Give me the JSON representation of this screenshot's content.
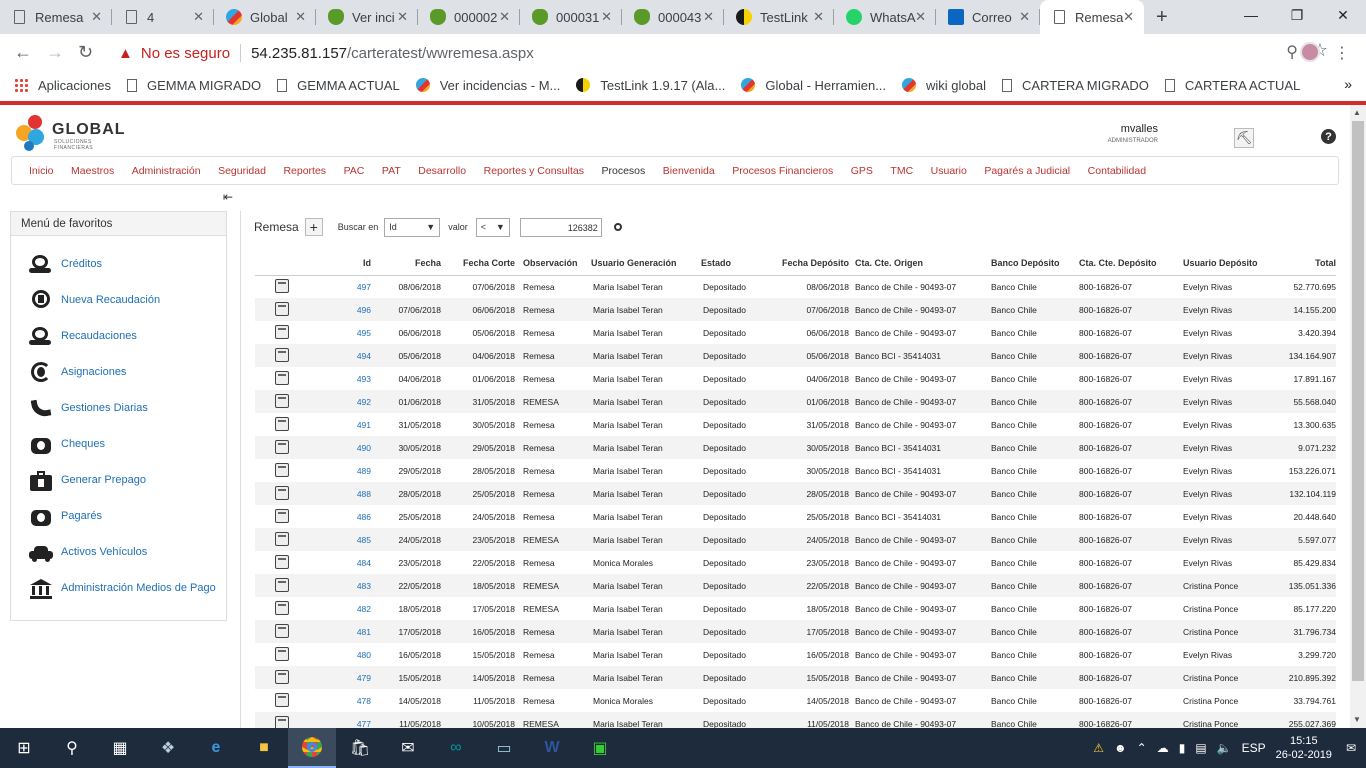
{
  "browser": {
    "tabs": [
      {
        "title": "Remesa",
        "icon": "doc-icon"
      },
      {
        "title": "4",
        "icon": "doc-icon"
      },
      {
        "title": "Global",
        "icon": "global-icon"
      },
      {
        "title": "Ver inci",
        "icon": "frog-icon"
      },
      {
        "title": "000002",
        "icon": "frog-icon"
      },
      {
        "title": "000031",
        "icon": "frog-icon"
      },
      {
        "title": "000043",
        "icon": "frog-icon"
      },
      {
        "title": "TestLink",
        "icon": "testlink-icon"
      },
      {
        "title": "WhatsA",
        "icon": "whatsapp-icon"
      },
      {
        "title": "Correo",
        "icon": "outlook-icon"
      },
      {
        "title": "Remesa",
        "icon": "doc-icon",
        "active": true
      }
    ],
    "security_label": "No es seguro",
    "url_host": "54.235.81.157",
    "url_path": "/carteratest/wwremesa.aspx",
    "bookmarks": [
      {
        "label": "Aplicaciones",
        "icon": "apps-icon"
      },
      {
        "label": "GEMMA MIGRADO",
        "icon": "doc-icon"
      },
      {
        "label": "GEMMA ACTUAL",
        "icon": "doc-icon"
      },
      {
        "label": "Ver incidencias - M...",
        "icon": "global-icon"
      },
      {
        "label": "TestLink 1.9.17 (Ala...",
        "icon": "testlink-icon"
      },
      {
        "label": "Global - Herramien...",
        "icon": "global-icon"
      },
      {
        "label": "wiki global",
        "icon": "global-icon"
      },
      {
        "label": "CARTERA MIGRADO",
        "icon": "doc-icon"
      },
      {
        "label": "CARTERA ACTUAL",
        "icon": "doc-icon"
      }
    ]
  },
  "app": {
    "logo_text": "GLOBAL",
    "logo_sub": "SOLUCIONES FINANCIERAS",
    "username": "mvalles",
    "role": "ADMINISTRADOR",
    "menu": [
      "Inicio",
      "Maestros",
      "Administración",
      "Seguridad",
      "Reportes",
      "PAC",
      "PAT",
      "Desarrollo",
      "Reportes y Consultas",
      "Procesos",
      "Bienvenida",
      "Procesos Financieros",
      "GPS",
      "TMC",
      "Usuario",
      "Pagarés a Judicial",
      "Contabilidad"
    ],
    "favorites_title": "Menú de favoritos",
    "favorites": [
      {
        "label": "Créditos",
        "icon": "money-hand-icon"
      },
      {
        "label": "Nueva Recaudación",
        "icon": "coin-cycle-icon"
      },
      {
        "label": "Recaudaciones",
        "icon": "money-hand-icon"
      },
      {
        "label": "Asignaciones",
        "icon": "money-refresh-icon"
      },
      {
        "label": "Gestiones Diarias",
        "icon": "phone-icon"
      },
      {
        "label": "Cheques",
        "icon": "money-bag-icon"
      },
      {
        "label": "Generar Prepago",
        "icon": "briefcase-money-icon"
      },
      {
        "label": "Pagarés",
        "icon": "money-bag-icon"
      },
      {
        "label": "Activos Vehículos",
        "icon": "car-icon"
      },
      {
        "label": "Administración Medios de Pago",
        "icon": "bank-icon"
      }
    ],
    "page_title": "Remesa",
    "search_label": "Buscar en",
    "search_field": "Id",
    "value_label": "valor",
    "operator": "<",
    "search_value": "126382"
  },
  "table": {
    "columns": [
      "",
      "Id",
      "Fecha",
      "Fecha Corte",
      "Observación",
      "Usuario Generación",
      "Estado",
      "Fecha Depósito",
      "Cta. Cte. Origen",
      "Banco Depósito",
      "Cta. Cte. Depósito",
      "Usuario Depósito",
      "Total"
    ],
    "rows": [
      [
        "497",
        "08/06/2018",
        "07/06/2018",
        "Remesa",
        "Maria Isabel Teran",
        "Depositado",
        "08/06/2018",
        "Banco de Chile - 90493-07",
        "Banco Chile",
        "800-16826-07",
        "Evelyn Rivas",
        "52.770.695"
      ],
      [
        "496",
        "07/06/2018",
        "06/06/2018",
        "Remesa",
        "Maria Isabel Teran",
        "Depositado",
        "07/06/2018",
        "Banco de Chile - 90493-07",
        "Banco Chile",
        "800-16826-07",
        "Evelyn Rivas",
        "14.155.200"
      ],
      [
        "495",
        "06/06/2018",
        "05/06/2018",
        "Remesa",
        "Maria Isabel Teran",
        "Depositado",
        "06/06/2018",
        "Banco de Chile - 90493-07",
        "Banco Chile",
        "800-16826-07",
        "Evelyn Rivas",
        "3.420.394"
      ],
      [
        "494",
        "05/06/2018",
        "04/06/2018",
        "Remesa",
        "Maria Isabel Teran",
        "Depositado",
        "05/06/2018",
        "Banco BCI - 35414031",
        "Banco Chile",
        "800-16826-07",
        "Evelyn Rivas",
        "134.164.907"
      ],
      [
        "493",
        "04/06/2018",
        "01/06/2018",
        "Remesa",
        "Maria Isabel Teran",
        "Depositado",
        "04/06/2018",
        "Banco de Chile - 90493-07",
        "Banco Chile",
        "800-16826-07",
        "Evelyn Rivas",
        "17.891.167"
      ],
      [
        "492",
        "01/06/2018",
        "31/05/2018",
        "REMESA",
        "Maria Isabel Teran",
        "Depositado",
        "01/06/2018",
        "Banco de Chile - 90493-07",
        "Banco Chile",
        "800-16826-07",
        "Evelyn Rivas",
        "55.568.040"
      ],
      [
        "491",
        "31/05/2018",
        "30/05/2018",
        "Remesa",
        "Maria Isabel Teran",
        "Depositado",
        "31/05/2018",
        "Banco de Chile - 90493-07",
        "Banco Chile",
        "800-16826-07",
        "Evelyn Rivas",
        "13.300.635"
      ],
      [
        "490",
        "30/05/2018",
        "29/05/2018",
        "Remesa",
        "Maria Isabel Teran",
        "Depositado",
        "30/05/2018",
        "Banco BCI - 35414031",
        "Banco Chile",
        "800-16826-07",
        "Evelyn Rivas",
        "9.071.232"
      ],
      [
        "489",
        "29/05/2018",
        "28/05/2018",
        "Remesa",
        "Maria Isabel Teran",
        "Depositado",
        "30/05/2018",
        "Banco BCI - 35414031",
        "Banco Chile",
        "800-16826-07",
        "Evelyn Rivas",
        "153.226.071"
      ],
      [
        "488",
        "28/05/2018",
        "25/05/2018",
        "Remesa",
        "Maria Isabel Teran",
        "Depositado",
        "28/05/2018",
        "Banco de Chile - 90493-07",
        "Banco Chile",
        "800-16826-07",
        "Evelyn Rivas",
        "132.104.119"
      ],
      [
        "486",
        "25/05/2018",
        "24/05/2018",
        "Remesa",
        "Maria Isabel Teran",
        "Depositado",
        "25/05/2018",
        "Banco BCI - 35414031",
        "Banco Chile",
        "800-16826-07",
        "Evelyn Rivas",
        "20.448.640"
      ],
      [
        "485",
        "24/05/2018",
        "23/05/2018",
        "REMESA",
        "Maria Isabel Teran",
        "Depositado",
        "24/05/2018",
        "Banco de Chile - 90493-07",
        "Banco Chile",
        "800-16826-07",
        "Evelyn Rivas",
        "5.597.077"
      ],
      [
        "484",
        "23/05/2018",
        "22/05/2018",
        "Remesa",
        "Monica Morales",
        "Depositado",
        "23/05/2018",
        "Banco de Chile - 90493-07",
        "Banco Chile",
        "800-16826-07",
        "Evelyn Rivas",
        "85.429.834"
      ],
      [
        "483",
        "22/05/2018",
        "18/05/2018",
        "REMESA",
        "Maria Isabel Teran",
        "Depositado",
        "22/05/2018",
        "Banco de Chile - 90493-07",
        "Banco Chile",
        "800-16826-07",
        "Cristina Ponce",
        "135.051.336"
      ],
      [
        "482",
        "18/05/2018",
        "17/05/2018",
        "REMESA",
        "Maria Isabel Teran",
        "Depositado",
        "18/05/2018",
        "Banco de Chile - 90493-07",
        "Banco Chile",
        "800-16826-07",
        "Cristina Ponce",
        "85.177.220"
      ],
      [
        "481",
        "17/05/2018",
        "16/05/2018",
        "Remesa",
        "Maria Isabel Teran",
        "Depositado",
        "17/05/2018",
        "Banco de Chile - 90493-07",
        "Banco Chile",
        "800-16826-07",
        "Cristina Ponce",
        "31.796.734"
      ],
      [
        "480",
        "16/05/2018",
        "15/05/2018",
        "Remesa",
        "Maria Isabel Teran",
        "Depositado",
        "16/05/2018",
        "Banco de Chile - 90493-07",
        "Banco Chile",
        "800-16826-07",
        "Evelyn Rivas",
        "3.299.720"
      ],
      [
        "479",
        "15/05/2018",
        "14/05/2018",
        "Remesa",
        "Maria Isabel Teran",
        "Depositado",
        "15/05/2018",
        "Banco de Chile - 90493-07",
        "Banco Chile",
        "800-16826-07",
        "Cristina Ponce",
        "210.895.392"
      ],
      [
        "478",
        "14/05/2018",
        "11/05/2018",
        "Remesa",
        "Monica Morales",
        "Depositado",
        "14/05/2018",
        "Banco de Chile - 90493-07",
        "Banco Chile",
        "800-16826-07",
        "Cristina Ponce",
        "33.794.761"
      ],
      [
        "477",
        "11/05/2018",
        "10/05/2018",
        "REMESA",
        "Maria Isabel Teran",
        "Depositado",
        "11/05/2018",
        "Banco de Chile - 90493-07",
        "Banco Chile",
        "800-16826-07",
        "Cristina Ponce",
        "255.027.369"
      ]
    ],
    "pdf_label": "PDF"
  },
  "taskbar": {
    "language": "ESP",
    "time": "15:15",
    "date": "26-02-2019"
  },
  "colors": {
    "accent_red": "#d42a2a",
    "link_blue": "#1f6fb5",
    "taskbar": "#1d2b3c"
  }
}
